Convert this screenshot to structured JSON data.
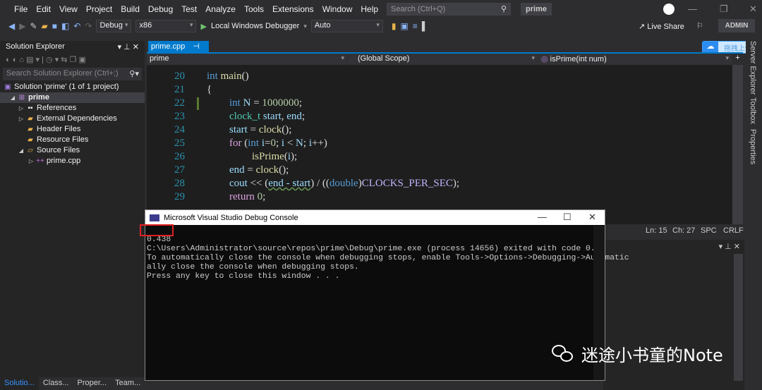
{
  "menu": [
    "File",
    "Edit",
    "View",
    "Project",
    "Build",
    "Debug",
    "Test",
    "Analyze",
    "Tools",
    "Extensions",
    "Window",
    "Help"
  ],
  "search_placeholder": "Search (Ctrl+Q)",
  "project_badge": "prime",
  "toolbar": {
    "config": "Debug",
    "platform": "x86",
    "run": "Local Windows Debugger",
    "auto": "Auto",
    "live_share": "Live Share",
    "user": "ADMIN"
  },
  "solution_explorer": {
    "title": "Solution Explorer",
    "search": "Search Solution Explorer (Ctrl+;)",
    "items": [
      "Solution 'prime' (1 of 1 project)",
      "prime",
      "References",
      "External Dependencies",
      "Header Files",
      "Resource Files",
      "Source Files",
      "prime.cpp"
    ],
    "tabs": [
      "Solutio...",
      "Class...",
      "Proper...",
      "Team..."
    ]
  },
  "editor": {
    "tab": "prime.cpp",
    "nav_project": "prime",
    "nav_scope": "(Global Scope)",
    "nav_member": "isPrime(int num)",
    "line_numbers": [
      "20",
      "21",
      "22",
      "23",
      "24",
      "25",
      "26",
      "27",
      "28",
      "29"
    ]
  },
  "status": {
    "ln": "Ln: 15",
    "ch": "Ch: 27",
    "spc": "SPC",
    "crlf": "CRLF"
  },
  "right_tabs": [
    "Server Explorer",
    "Toolbox",
    "Properties"
  ],
  "baidu": "拖拽上传",
  "console": {
    "title": "Microsoft Visual Studio Debug Console",
    "lines": [
      "0.438",
      "C:\\Users\\Administrator\\source\\repos\\prime\\Debug\\prime.exe (process 14656) exited with code 0.",
      "To automatically close the console when debugging stops, enable Tools->Options->Debugging->Automatic",
      "ally close the console when debugging stops.",
      "Press any key to close this window . . ."
    ]
  },
  "watermark": "迷途小书童的Note",
  "colors": {
    "accent": "#007acc",
    "highlight_box": "#e02020"
  }
}
